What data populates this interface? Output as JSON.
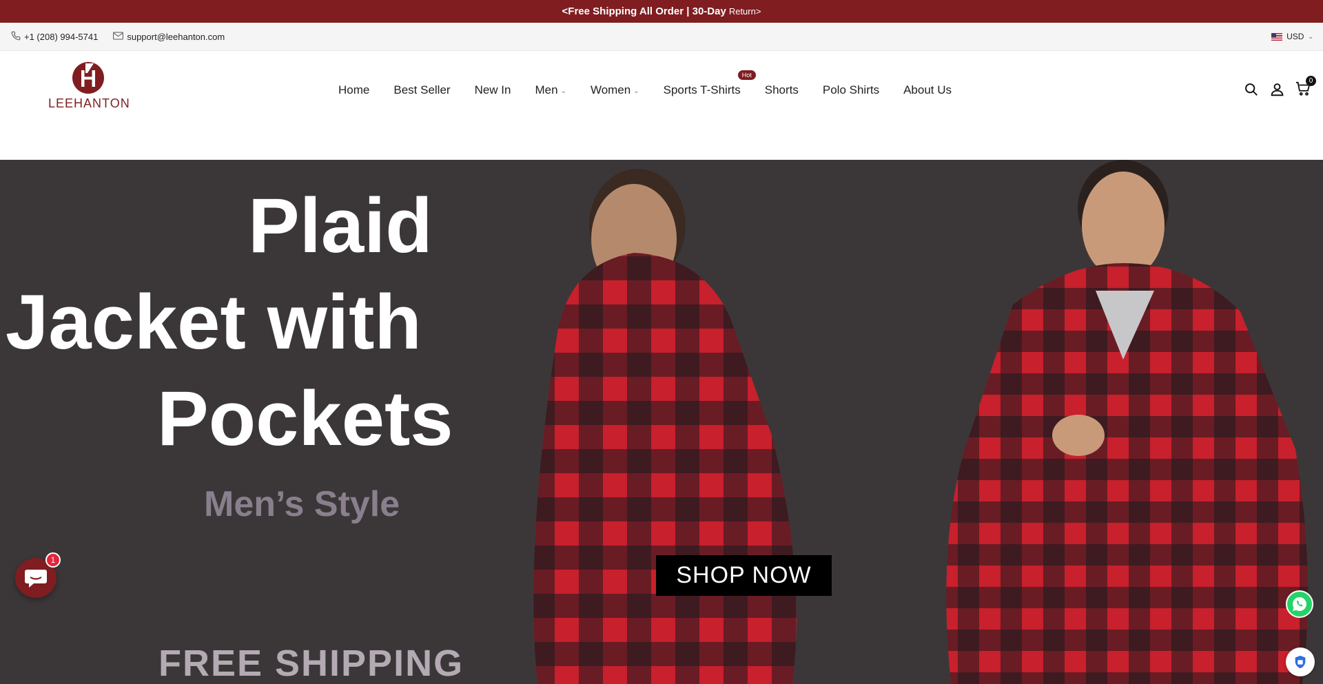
{
  "announcement": {
    "arrow_left": "<",
    "text_bold": "Free Shipping All Order | 30-Day",
    "text_light": "Return",
    "arrow_right": ">"
  },
  "topbar": {
    "phone": "+1 (208) 994-5741",
    "email": "support@leehanton.com",
    "currency": "USD"
  },
  "header": {
    "logo_text": "LEEHANTON",
    "nav": [
      {
        "label": "Home"
      },
      {
        "label": "Best Seller"
      },
      {
        "label": "New In"
      },
      {
        "label": "Men",
        "dropdown": true
      },
      {
        "label": "Women",
        "dropdown": true
      },
      {
        "label": "Sports T-Shirts",
        "badge": "Hot"
      },
      {
        "label": "Shorts"
      },
      {
        "label": "Polo Shirts"
      },
      {
        "label": "About Us"
      }
    ],
    "cart_count": "0",
    "icons": [
      "search-icon",
      "account-icon",
      "cart-icon"
    ]
  },
  "hero": {
    "line1": "Plaid",
    "line2": "Jacket with",
    "line3": "Pockets",
    "subtitle": "Men’s Style",
    "cta": "SHOP NOW",
    "footer_text": "FREE SHIPPING"
  },
  "widgets": {
    "chat_badge": "1"
  },
  "colors": {
    "brand": "#7f1d21",
    "hero_bg": "#3b3739",
    "plaid_red": "#c8202c",
    "plaid_black": "#1b1a1d",
    "whatsapp": "#25d366"
  }
}
